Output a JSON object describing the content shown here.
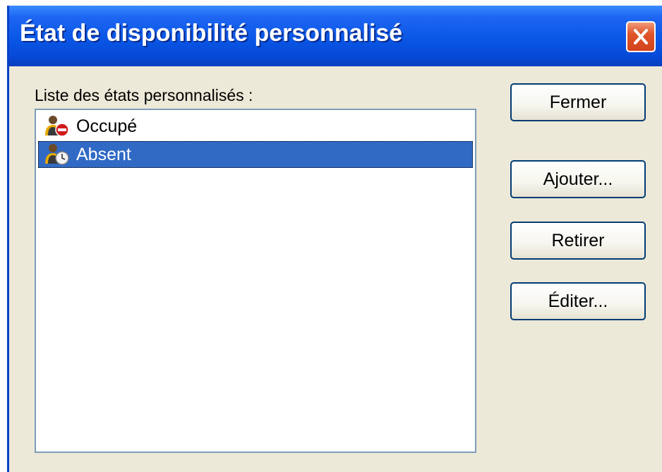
{
  "window": {
    "title": "État de disponibilité personnalisé",
    "close_icon": "close-icon"
  },
  "list": {
    "label": "Liste des états personnalisés :",
    "items": [
      {
        "label": "Occupé",
        "icon": "busy-user-icon",
        "selected": false
      },
      {
        "label": "Absent",
        "icon": "away-user-icon",
        "selected": true
      }
    ]
  },
  "buttons": {
    "close_label": "Fermer",
    "add_label": "Ajouter...",
    "remove_label": "Retirer",
    "edit_label": "Éditer..."
  },
  "colors": {
    "titlebar": "#0a57e6",
    "selection": "#316ac5",
    "window_bg": "#ece9d8",
    "close_button": "#e0552a"
  }
}
